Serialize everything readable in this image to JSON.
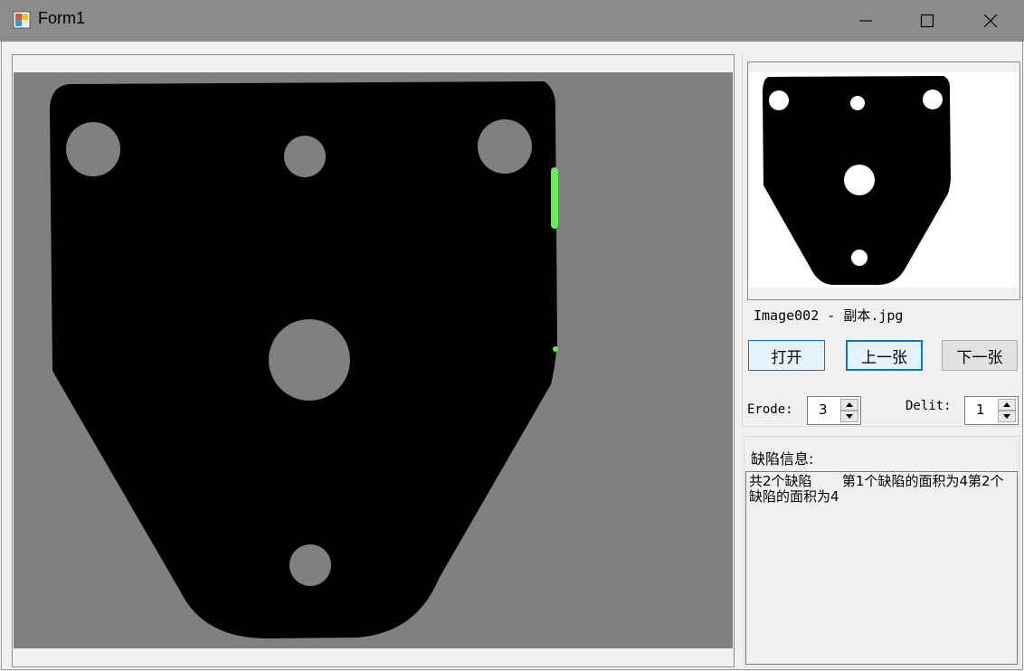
{
  "window": {
    "title": "Form1"
  },
  "icons": {
    "app": "app-icon",
    "minimize": "minimize-icon",
    "maximize": "maximize-icon",
    "close": "close-icon",
    "spin_up": "spin-up-icon",
    "spin_down": "spin-down-icon"
  },
  "viewer": {
    "file_name": "Image002 - 副本.jpg"
  },
  "buttons": {
    "open": "打开",
    "previous": "上一张",
    "next": "下一张"
  },
  "erode": {
    "label": "Erode:",
    "value": "3"
  },
  "delit": {
    "label": "Delit:",
    "value": "1"
  },
  "defects": {
    "title": "缺陷信息:",
    "text": "共2个缺陷       第1个缺陷的面积为4第2个缺陷的面积为4"
  },
  "colors": {
    "titlebar": "#8c8c8c",
    "view_background": "#808080",
    "part": "#000000",
    "defect_highlight": "#66ee55",
    "button_focus_border": "#0078d7"
  }
}
